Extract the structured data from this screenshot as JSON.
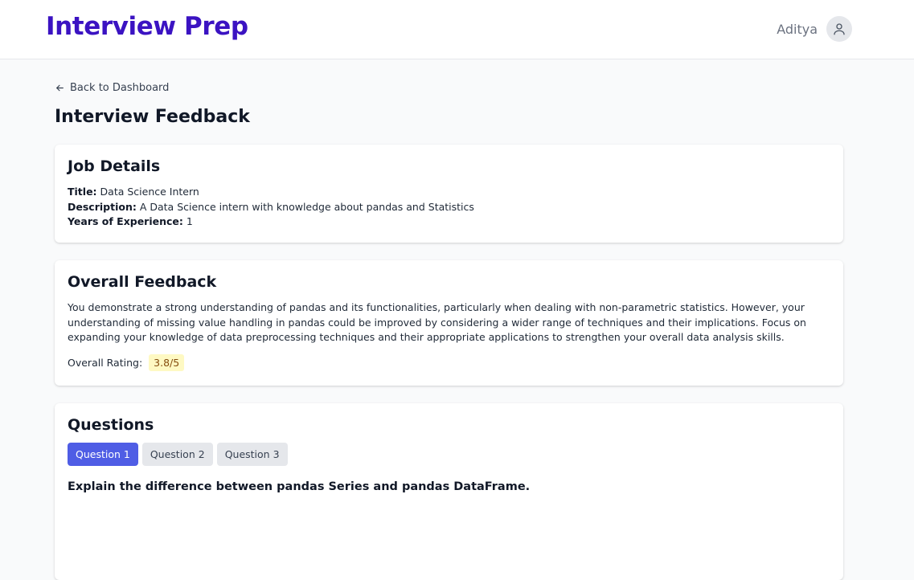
{
  "header": {
    "brand": "Interview Prep",
    "user_name": "Aditya"
  },
  "nav": {
    "back_label": "Back to Dashboard"
  },
  "page": {
    "title": "Interview Feedback"
  },
  "job_details": {
    "heading": "Job Details",
    "title_label": "Title:",
    "title_value": "Data Science Intern",
    "description_label": "Description:",
    "description_value": "A Data Science intern with knowledge about pandas and Statistics",
    "experience_label": "Years of Experience:",
    "experience_value": "1"
  },
  "overall_feedback": {
    "heading": "Overall Feedback",
    "text": "You demonstrate a strong understanding of pandas and its functionalities, particularly when dealing with non-parametric statistics. However, your understanding of missing value handling in pandas could be improved by considering a wider range of techniques and their implications. Focus on expanding your knowledge of data preprocessing techniques and their appropriate applications to strengthen your overall data analysis skills.",
    "rating_label": "Overall Rating:",
    "rating_value": "3.8/5"
  },
  "questions": {
    "heading": "Questions",
    "tabs": [
      "Question 1",
      "Question 2",
      "Question 3"
    ],
    "active_tab": 0,
    "current_question": "Explain the difference between pandas Series and pandas DataFrame."
  },
  "colors": {
    "brand": "#3b13c2",
    "active_tab": "#4f5de5",
    "rating_bg": "#fef9c3",
    "rating_text": "#854d0e"
  },
  "icons": {
    "back": "arrow-left-icon",
    "avatar": "user-icon"
  }
}
